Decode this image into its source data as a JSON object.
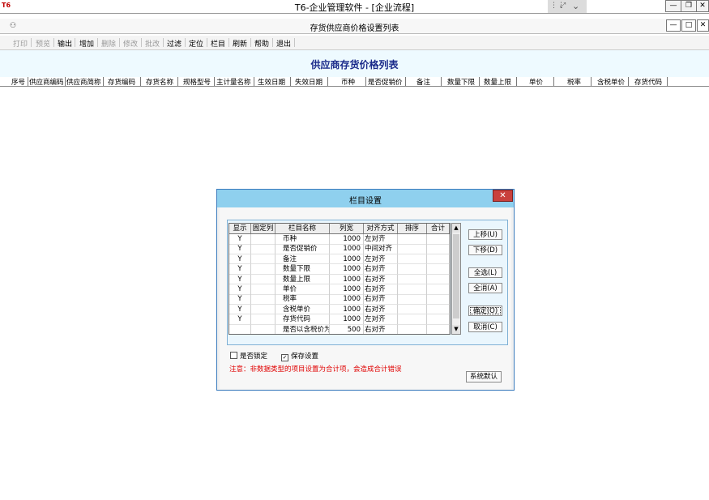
{
  "app": {
    "logo": "T6",
    "title": "T6-企业管理软件 - [企业流程]",
    "minimize": "—",
    "restore": "❐",
    "close": "✕"
  },
  "window": {
    "title": "存货供应商价格设置列表",
    "minimize": "—",
    "restore": "□",
    "close": "✕"
  },
  "toolbar": {
    "items": [
      "打印",
      "预览",
      "输出",
      "增加",
      "删除",
      "修改",
      "批改",
      "过滤",
      "定位",
      "栏目",
      "刷新",
      "帮助",
      "退出"
    ],
    "disabled": [
      true,
      true,
      false,
      false,
      true,
      true,
      true,
      false,
      false,
      false,
      false,
      false,
      false
    ]
  },
  "report": {
    "title": "供应商存货价格列表",
    "columns": [
      "序号",
      "供应商编码",
      "供应商简称",
      "存货编码",
      "存货名称",
      "规格型号",
      "主计量名称",
      "生效日期",
      "失效日期",
      "币种",
      "是否促销价",
      "备注",
      "数量下限",
      "数量上限",
      "单价",
      "税率",
      "含税单价",
      "存货代码"
    ]
  },
  "dialog": {
    "title": "栏目设置",
    "close": "✕",
    "headers": [
      "显示",
      "固定列",
      "栏目名称",
      "列宽",
      "对齐方式",
      "排序",
      "合计"
    ],
    "rows": [
      {
        "show": "Y",
        "fixed": "",
        "name": "币种",
        "width": "1000",
        "align": "左对齐",
        "sort": "",
        "sum": ""
      },
      {
        "show": "Y",
        "fixed": "",
        "name": "是否促销价",
        "width": "1000",
        "align": "中间对齐",
        "sort": "",
        "sum": ""
      },
      {
        "show": "Y",
        "fixed": "",
        "name": "备注",
        "width": "1000",
        "align": "左对齐",
        "sort": "",
        "sum": ""
      },
      {
        "show": "Y",
        "fixed": "",
        "name": "数量下限",
        "width": "1000",
        "align": "右对齐",
        "sort": "",
        "sum": ""
      },
      {
        "show": "Y",
        "fixed": "",
        "name": "数量上限",
        "width": "1000",
        "align": "右对齐",
        "sort": "",
        "sum": ""
      },
      {
        "show": "Y",
        "fixed": "",
        "name": "单价",
        "width": "1000",
        "align": "右对齐",
        "sort": "",
        "sum": ""
      },
      {
        "show": "Y",
        "fixed": "",
        "name": "税率",
        "width": "1000",
        "align": "右对齐",
        "sort": "",
        "sum": ""
      },
      {
        "show": "Y",
        "fixed": "",
        "name": "含税单价",
        "width": "1000",
        "align": "右对齐",
        "sort": "",
        "sum": ""
      },
      {
        "show": "Y",
        "fixed": "",
        "name": "存货代码",
        "width": "1000",
        "align": "左对齐",
        "sort": "",
        "sum": ""
      },
      {
        "show": "",
        "fixed": "",
        "name": "是否以含税价为主",
        "width": "500",
        "align": "右对齐",
        "sort": "",
        "sum": ""
      }
    ],
    "buttons": {
      "move_up": "上移(U)",
      "move_down": "下移(D)",
      "select_all": "全选(L)",
      "clear_all": "全消(A)",
      "confirm": "确定(O)",
      "cancel": "取消(C)",
      "system_default": "系统默认"
    },
    "checkboxes": {
      "lock_label": "是否锁定",
      "lock_checked": "",
      "save_label": "保存设置",
      "save_checked": "✓"
    },
    "note": "注意：非数据类型的项目设置为合计项，会造成合计错误",
    "scroll_up": "▲",
    "scroll_down": "▼"
  }
}
